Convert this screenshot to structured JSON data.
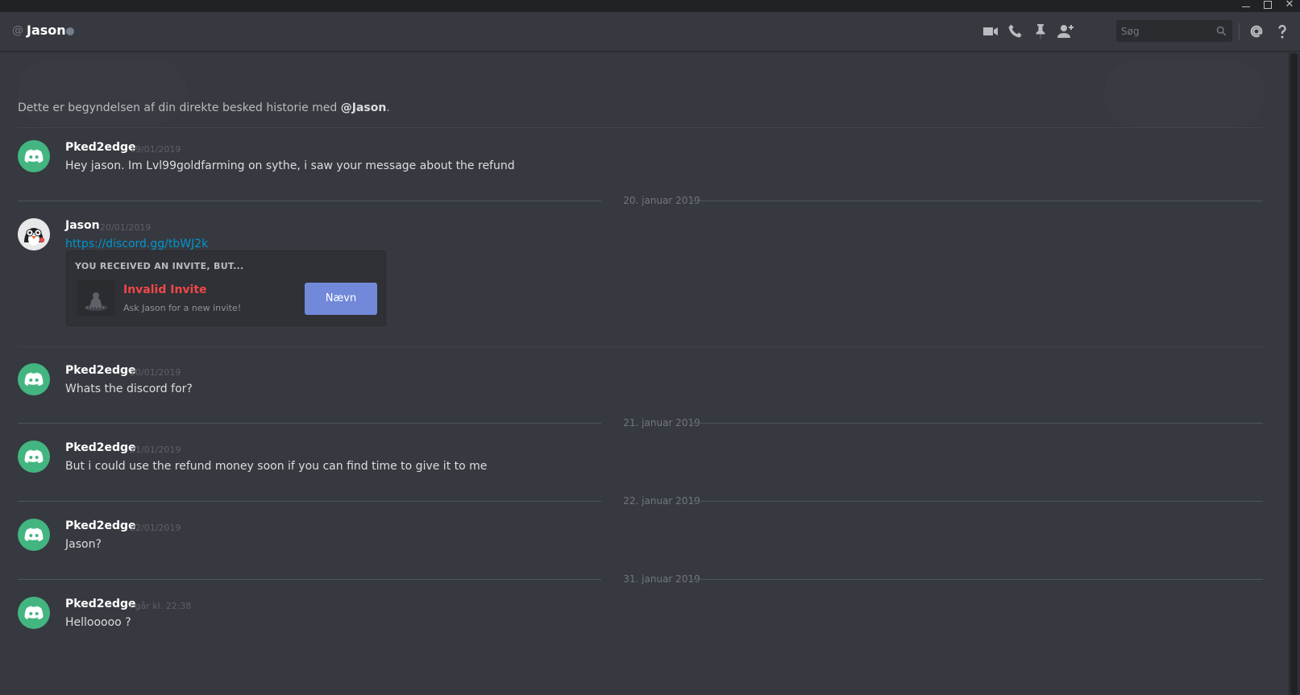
{
  "window": {
    "min": "—",
    "close": "✕"
  },
  "header": {
    "at_symbol": "@",
    "name": "Jason",
    "search_placeholder": "Søg"
  },
  "intro": {
    "prefix": "Dette er begyndelsen af din direkte besked historie med ",
    "mention": "@Jason",
    "suffix": "."
  },
  "messages": [
    {
      "author": "Pked2edge",
      "time": "19/01/2019",
      "text": "Hey jason. Im Lvl99goldfarming on sythe, i saw your message about the refund"
    },
    {
      "author": "Jason",
      "time": "20/01/2019",
      "link": "https://discord.gg/tbWJ2k",
      "invite": {
        "title": "YOU RECEIVED AN INVITE, BUT...",
        "name": "Invalid Invite",
        "subtitle": "Ask Jason for a new invite!",
        "button": "Nævn"
      }
    },
    {
      "author": "Pked2edge",
      "time": "20/01/2019",
      "text": "Whats the discord for?"
    },
    {
      "author": "Pked2edge",
      "time": "21/01/2019",
      "text": "But i could use the refund money soon if you can find time to give it to me"
    },
    {
      "author": "Pked2edge",
      "time": "22/01/2019",
      "text": "Jason?"
    },
    {
      "author": "Pked2edge",
      "time": "i går kl. 22:38",
      "text": "Hellooooo ?"
    }
  ],
  "day_separators": [
    "20. januar 2019",
    "21. januar 2019",
    "22. januar 2019",
    "31. januar 2019"
  ],
  "icons": [
    "video-call-icon",
    "phone-call-icon",
    "pin-icon",
    "add-friend-icon",
    "search-icon",
    "mention-icon",
    "help-icon"
  ],
  "colors": {
    "background": "#36393f",
    "accent": "#7289da",
    "discord_green": "#43b581",
    "error": "#f04747",
    "link": "#0096cf"
  }
}
